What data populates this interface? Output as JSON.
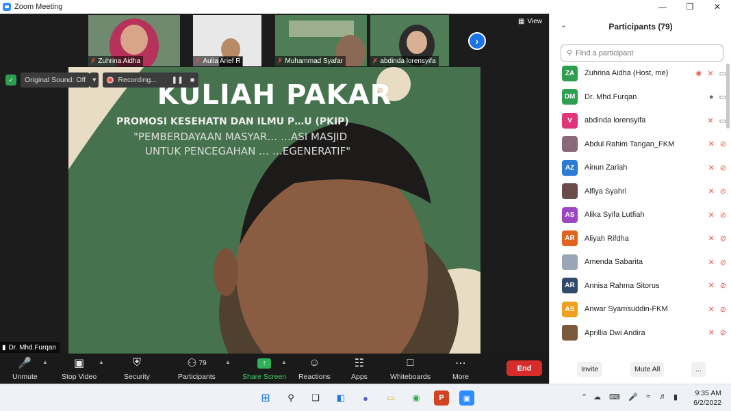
{
  "window": {
    "title": "Zoom Meeting"
  },
  "thumbnails": [
    {
      "name": "Zuhrina Aidha"
    },
    {
      "name": "Aulia Arief R"
    },
    {
      "name": "Muhammad Syafar"
    },
    {
      "name": "abdinda lorensyifa"
    }
  ],
  "view_label": "View",
  "sound": {
    "original_sound": "Original Sound: Off",
    "recording": "Recording..."
  },
  "slide": {
    "title": "KULIAH PAKAR",
    "subtitle": "PROMOSI KESEHATN DAN ILMU P…U (PKIP)",
    "quote1": "\"PEMBERDAYAAN MASYAR… …ASI MASJID",
    "quote2": "UNTUK PENCEGAHAN … …EGENERATIF\""
  },
  "speaker": {
    "name": "Dr. Mhd.Furqan"
  },
  "toolbar": {
    "unmute": "Unmute",
    "stop_video": "Stop Video",
    "security": "Security",
    "participants": "Participants",
    "participants_count": "79",
    "share_screen": "Share Screen",
    "reactions": "Reactions",
    "apps": "Apps",
    "whiteboards": "Whiteboards",
    "more": "More",
    "end": "End"
  },
  "panel": {
    "title": "Participants (79)",
    "search_placeholder": "Find a participant",
    "participants": [
      {
        "initials": "ZA",
        "name": "Zuhrina Aidha (Host, me)",
        "color": "#2e9e4f",
        "mic": "off",
        "cam": "on",
        "rec": true
      },
      {
        "initials": "DM",
        "name": "Dr. Mhd.Furqan",
        "color": "#2e9e4f",
        "mic": "on",
        "cam": "on",
        "rec": false
      },
      {
        "initials": "V",
        "name": "abdinda lorensyifa",
        "color": "#e0357a",
        "mic": "off",
        "cam": "on",
        "rec": false
      },
      {
        "initials": "",
        "name": "Abdul Rahim Tarigan_FKM",
        "color": "#8a6a7a",
        "mic": "off",
        "cam": "off",
        "rec": false
      },
      {
        "initials": "AZ",
        "name": "Ainun Zariah",
        "color": "#2a7bd4",
        "mic": "off",
        "cam": "off",
        "rec": false
      },
      {
        "initials": "",
        "name": "Alfiya Syahri",
        "color": "#6b4a4a",
        "mic": "off",
        "cam": "off",
        "rec": false
      },
      {
        "initials": "AS",
        "name": "Alika Syifa Lutfiah",
        "color": "#9b46c2",
        "mic": "off",
        "cam": "off",
        "rec": false
      },
      {
        "initials": "AR",
        "name": "Aliyah Rifdha",
        "color": "#e0641e",
        "mic": "off",
        "cam": "off",
        "rec": false
      },
      {
        "initials": "",
        "name": "Amenda Sabarita",
        "color": "#9aa6b8",
        "mic": "off",
        "cam": "off",
        "rec": false
      },
      {
        "initials": "AR",
        "name": "Annisa Rahma Sitorus",
        "color": "#2f4a6b",
        "mic": "off",
        "cam": "off",
        "rec": false
      },
      {
        "initials": "AS",
        "name": "Anwar Syamsuddin-FKM",
        "color": "#f0a020",
        "mic": "off",
        "cam": "off",
        "rec": false
      },
      {
        "initials": "",
        "name": "Aprillia Dwi Andira",
        "color": "#7a5a3a",
        "mic": "off",
        "cam": "off",
        "rec": false
      }
    ],
    "invite": "Invite",
    "mute_all": "Mute All",
    "more": "..."
  },
  "taskbar": {
    "time": "9:35 AM",
    "date": "6/2/2022"
  }
}
